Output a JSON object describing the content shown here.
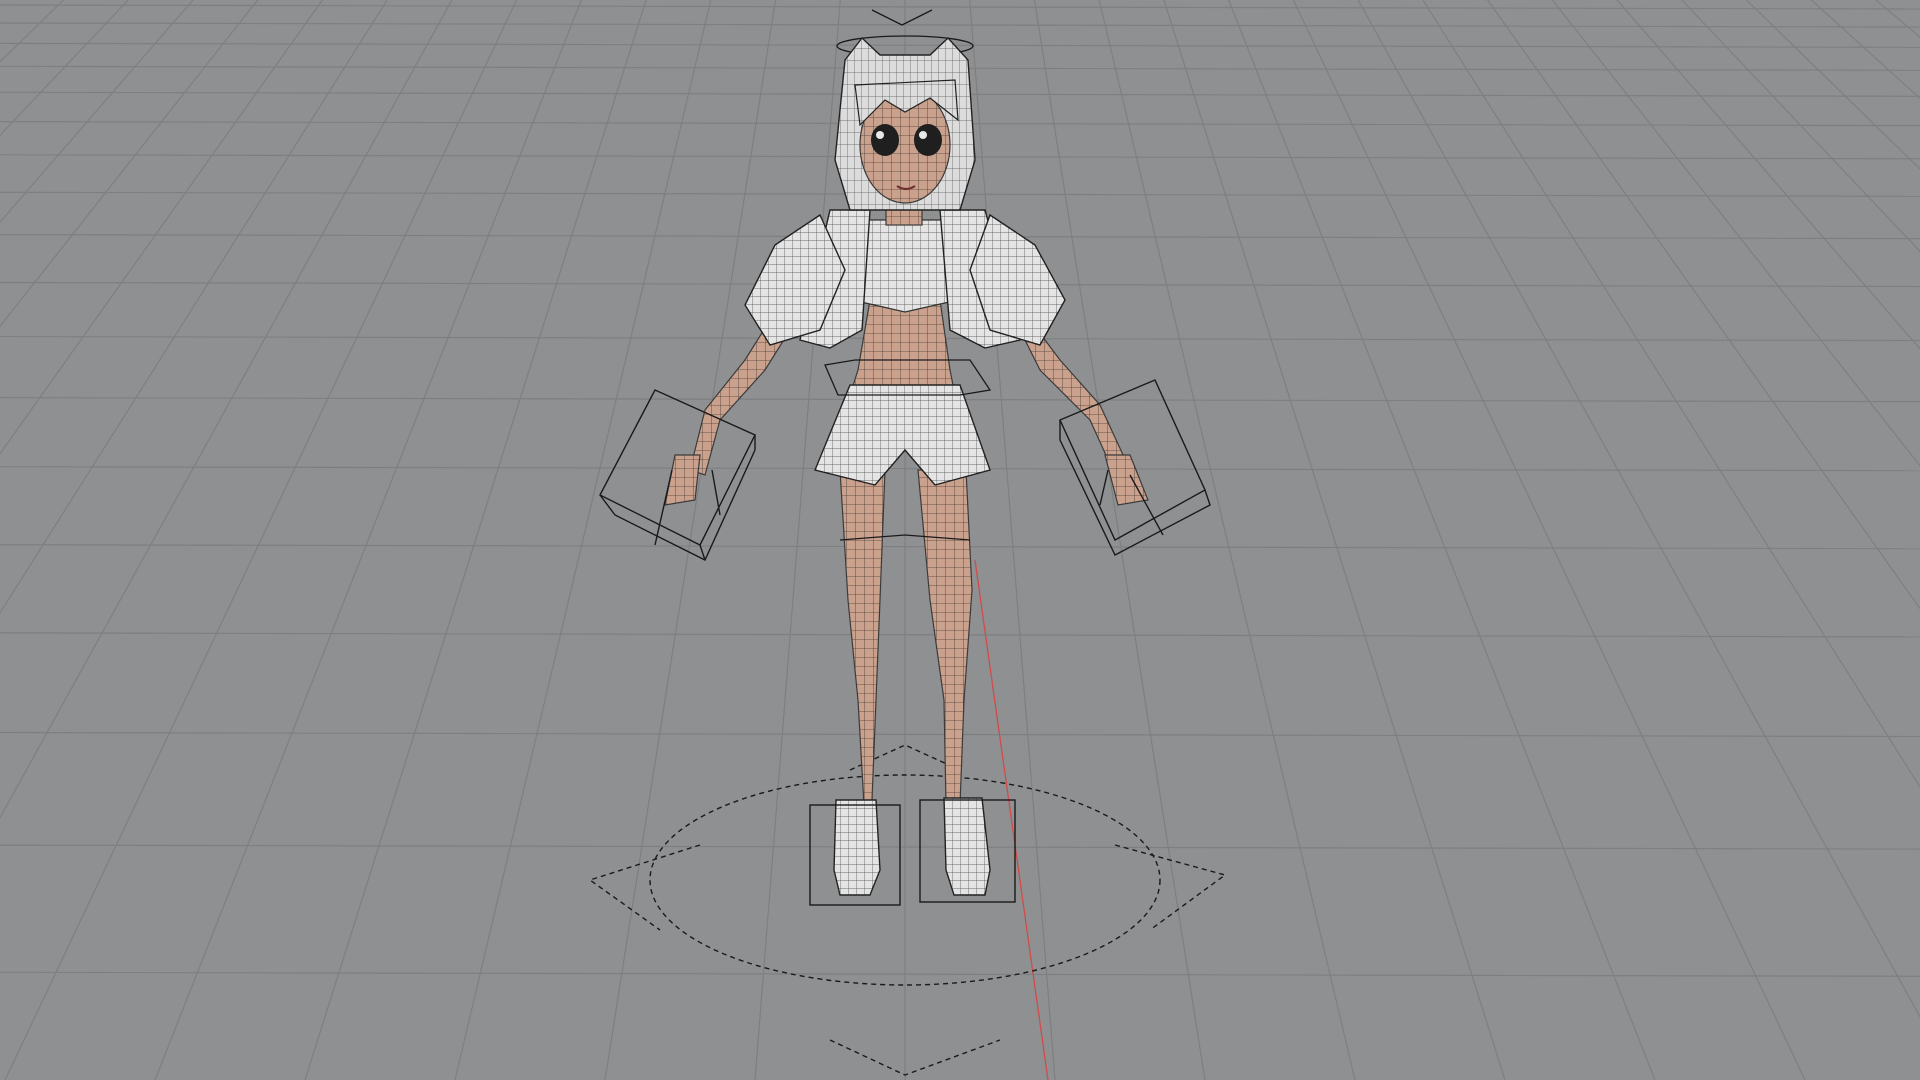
{
  "viewport": {
    "view": "perspective",
    "background_color": "#8f9092",
    "grid_color": "#7e7f81",
    "axis_color": "#d24a4a",
    "overlay": "wireframe"
  },
  "scene": {
    "object": "stylized-anime-girl-character",
    "skin_color": "#c9a18d",
    "cloth_color": "#e6e6e6",
    "wire_color": "#3b3b3b",
    "hair_color": "#dcdcdc",
    "controls": [
      "head-halo-control",
      "left-hand-ik-control",
      "right-hand-ik-control",
      "hip-control",
      "left-foot-control",
      "right-foot-control",
      "root-control"
    ]
  }
}
